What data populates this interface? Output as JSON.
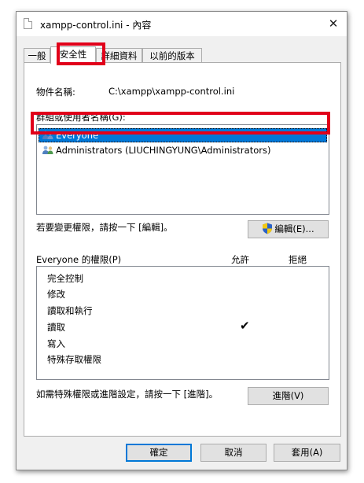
{
  "window": {
    "title": "xampp-control.ini - 內容",
    "close_glyph": "✕"
  },
  "tabs": [
    {
      "label": "一般",
      "active": false
    },
    {
      "label": "安全性",
      "active": true
    },
    {
      "label": "詳細資料",
      "active": false
    },
    {
      "label": "以前的版本",
      "active": false
    }
  ],
  "security": {
    "object_name_label": "物件名稱:",
    "object_name_value": "C:\\xampp\\xampp-control.ini",
    "groups_label": "群組或使用者名稱(G):",
    "principals": [
      {
        "name": "Everyone",
        "selected": true,
        "icon": "users-icon"
      },
      {
        "name": "Administrators (LIUCHINGYUNG\\Administrators)",
        "selected": false,
        "icon": "users-icon"
      }
    ],
    "edit_hint": "若要變更權限，請按一下 [編輯]。",
    "edit_button": "編輯(E)...",
    "permissions_label": "Everyone 的權限(P)",
    "allow_header": "允許",
    "deny_header": "拒絕",
    "permissions": [
      {
        "name": "完全控制",
        "allow": false,
        "deny": false
      },
      {
        "name": "修改",
        "allow": false,
        "deny": false
      },
      {
        "name": "讀取和執行",
        "allow": false,
        "deny": false
      },
      {
        "name": "讀取",
        "allow": true,
        "deny": false
      },
      {
        "name": "寫入",
        "allow": false,
        "deny": false
      },
      {
        "name": "特殊存取權限",
        "allow": false,
        "deny": false
      }
    ],
    "check_glyph": "✔",
    "advanced_hint": "如需特殊權限或進階設定，請按一下 [進階]。",
    "advanced_button": "進階(V)"
  },
  "footer": {
    "ok": "確定",
    "cancel": "取消",
    "apply": "套用(A)"
  },
  "colors": {
    "selection": "#0078d7",
    "annotation": "#e1001a",
    "shield_blue": "#2b62c7",
    "shield_yellow": "#f2c811"
  }
}
